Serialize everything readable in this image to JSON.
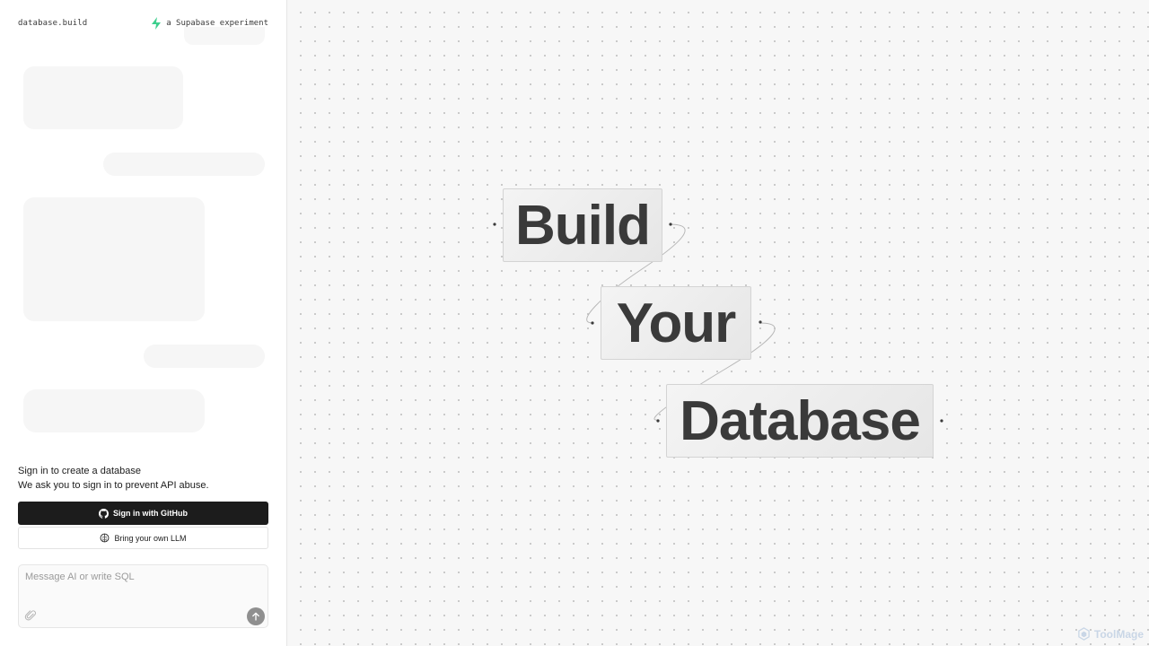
{
  "header": {
    "brand": "database.build",
    "tagline": "a Supabase experiment",
    "tagline_icon": "supabase-bolt-icon"
  },
  "auth": {
    "title": "Sign in to create a database",
    "description": "We ask you to sign in to prevent API abuse.",
    "github_button_label": "Sign in with GitHub",
    "github_icon": "github-icon",
    "llm_button_label": "Bring your own LLM",
    "llm_icon": "brain-icon"
  },
  "composer": {
    "placeholder": "Message AI or write SQL",
    "value": "",
    "attach_icon": "paperclip-icon",
    "send_icon": "arrow-up-icon"
  },
  "canvas": {
    "words": [
      "Build",
      "Your",
      "Database"
    ]
  },
  "watermark": {
    "label": "ToolMage"
  },
  "colors": {
    "primary_button": "#1c1c1c",
    "supabase_green": "#3ecf8e",
    "canvas_bg": "#f7f7f7"
  }
}
